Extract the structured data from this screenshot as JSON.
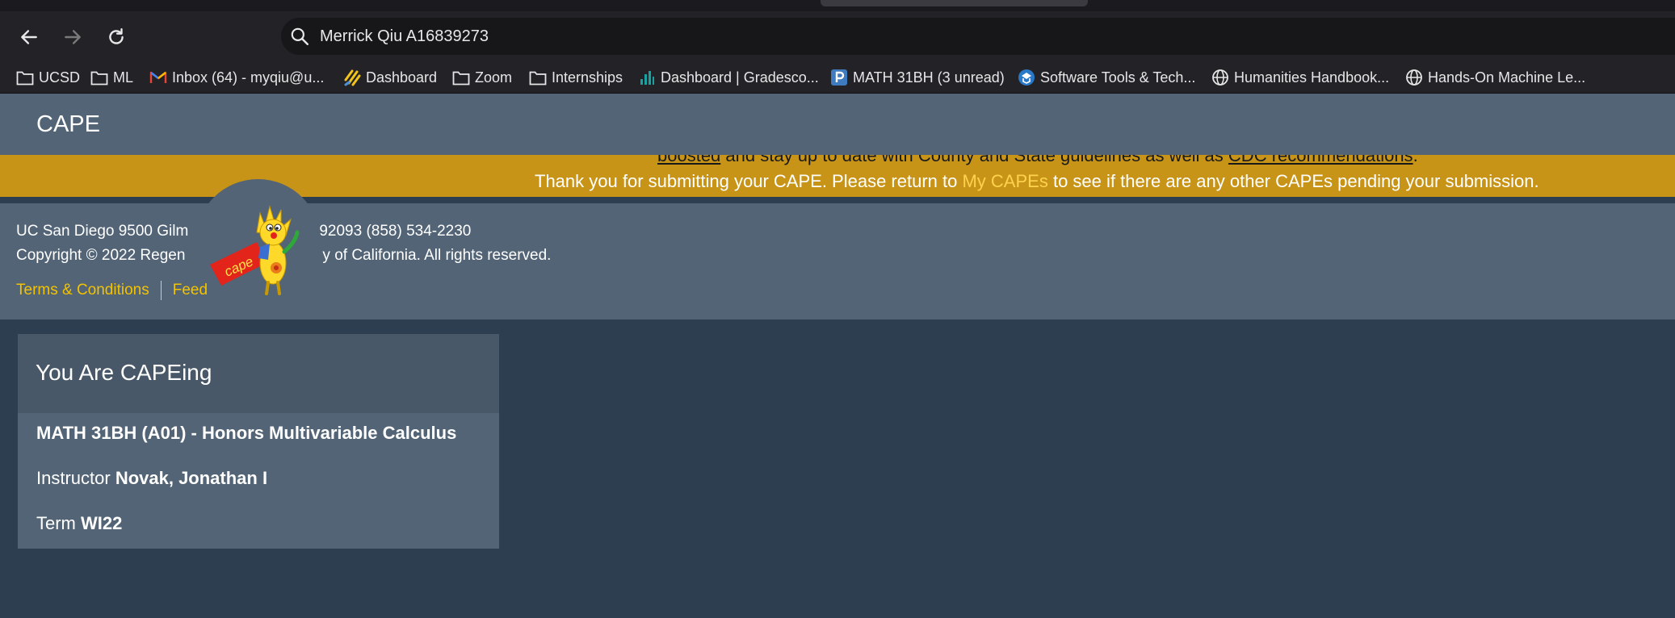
{
  "browser": {
    "address": "Merrick Qiu A16839273",
    "nav": {
      "back_icon": "arrow-left-icon",
      "forward_icon": "arrow-right-icon",
      "reload_icon": "reload-icon"
    },
    "bookmarks": [
      {
        "label": "UCSD",
        "icon": "folder-icon"
      },
      {
        "label": "ML",
        "icon": "folder-icon"
      },
      {
        "label": "Inbox (64) - myqiu@u...",
        "icon": "gmail-icon"
      },
      {
        "label": "Dashboard",
        "icon": "canvas-icon"
      },
      {
        "label": "Zoom",
        "icon": "folder-icon"
      },
      {
        "label": "Internships",
        "icon": "folder-icon"
      },
      {
        "label": "Dashboard | Gradesco...",
        "icon": "gradescope-icon"
      },
      {
        "label": "MATH 31BH (3 unread)",
        "icon": "piazza-icon"
      },
      {
        "label": "Software Tools & Tech...",
        "icon": "site-icon"
      },
      {
        "label": "Humanities Handbook...",
        "icon": "globe-icon"
      },
      {
        "label": "Hands-On Machine Le...",
        "icon": "globe-icon"
      }
    ]
  },
  "header": {
    "brand": "CAPE"
  },
  "notice": {
    "partial_line": {
      "link1": "boosted",
      "mid": " and stay up to date with County and State guidelines as well as ",
      "link2": "CDC recommendations",
      "end": "."
    },
    "thanks_before": "Thank you for submitting your CAPE. Please return to ",
    "thanks_link": "My CAPEs",
    "thanks_after": " to see if there are any other CAPEs pending your submission."
  },
  "footer": {
    "address_left": "UC San Diego 9500 Gilm",
    "address_right": "92093 (858) 534-2230",
    "copyright_left": "Copyright © 2022 Regen",
    "copyright_right": "y of California. All rights reserved.",
    "terms": "Terms & Conditions",
    "feedback": "Feed"
  },
  "card": {
    "title": "You Are CAPEing",
    "course": "MATH 31BH (A01) - Honors Multivariable Calculus",
    "instructor_label": "Instructor ",
    "instructor": "Novak, Jonathan I",
    "term_label": "Term ",
    "term": "WI22"
  },
  "colors": {
    "header_bg": "#526476",
    "page_bg": "#2c3e50",
    "notice_bg": "#c89418",
    "link_yellow": "#f3c300"
  },
  "mascot": {
    "sign_text": "cape"
  }
}
